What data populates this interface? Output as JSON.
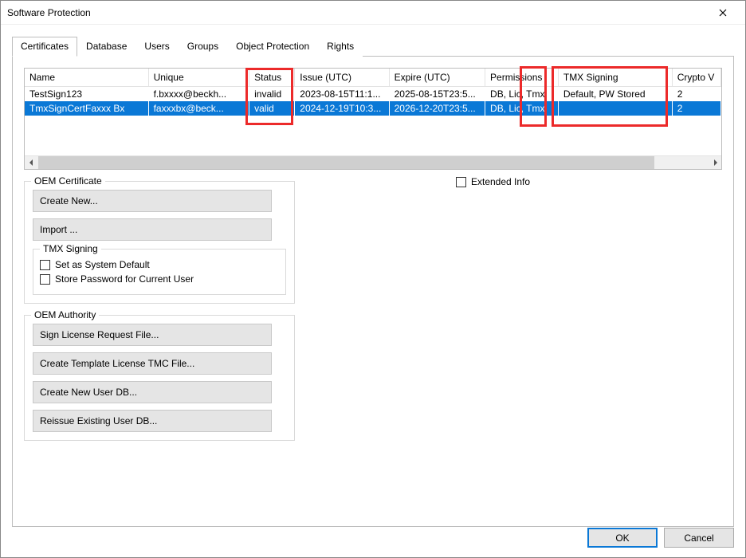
{
  "window": {
    "title": "Software Protection"
  },
  "tabs": {
    "certificates": "Certificates",
    "database": "Database",
    "users": "Users",
    "groups": "Groups",
    "object_protection": "Object Protection",
    "rights": "Rights"
  },
  "grid": {
    "headers": {
      "name": "Name",
      "unique": "Unique",
      "status": "Status",
      "issue": "Issue (UTC)",
      "expire": "Expire (UTC)",
      "permissions": "Permissions",
      "tmx_signing": "TMX Signing",
      "crypto_v": "Crypto V"
    },
    "rows": [
      {
        "name": "TestSign123",
        "unique": "f.bxxxx@beckh...",
        "status": "invalid",
        "issue": "2023-08-15T11:1...",
        "expire": "2025-08-15T23:5...",
        "permissions": "DB, Lic, Tmx",
        "tmx_signing": "Default, PW Stored",
        "crypto_v": "2",
        "selected": false
      },
      {
        "name": "TmxSignCertFaxxx Bx",
        "unique": "faxxxbx@beck...",
        "status": "valid",
        "issue": "2024-12-19T10:3...",
        "expire": "2026-12-20T23:5...",
        "permissions": "DB, Lic, Tmx",
        "tmx_signing": "",
        "crypto_v": "2",
        "selected": true
      }
    ]
  },
  "extended_info_label": "Extended Info",
  "oem_certificate": {
    "legend": "OEM Certificate",
    "create_new": "Create New...",
    "import": "Import ...",
    "tmx_legend": "TMX Signing",
    "set_default": "Set as System Default",
    "store_pw": "Store Password for Current User"
  },
  "oem_authority": {
    "legend": "OEM Authority",
    "sign_license": "Sign License Request File...",
    "create_template": "Create Template License TMC File...",
    "create_userdb": "Create New User DB...",
    "reissue_userdb": "Reissue Existing User DB..."
  },
  "buttons": {
    "ok": "OK",
    "cancel": "Cancel"
  }
}
